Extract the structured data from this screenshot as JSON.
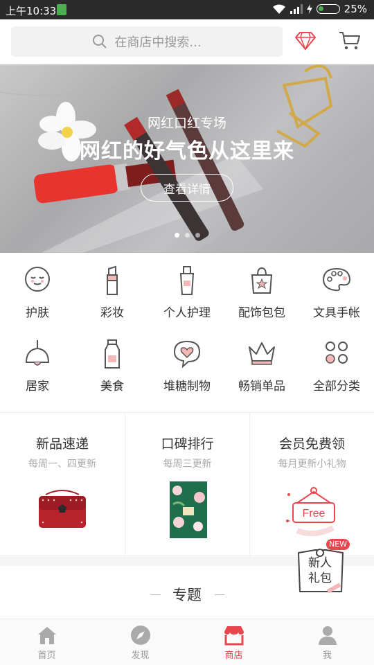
{
  "status_bar": {
    "time": "上午10:33",
    "battery": "25%",
    "battery_level": 0.25
  },
  "search": {
    "placeholder": "在商店中搜索..."
  },
  "banner": {
    "subtitle": "网红口红专场",
    "title": "网红的好气色从这里来",
    "button": "查看详情",
    "active_dot": 0,
    "dot_count": 3
  },
  "categories": [
    {
      "label": "护肤",
      "icon": "face-icon"
    },
    {
      "label": "彩妆",
      "icon": "lipstick-icon"
    },
    {
      "label": "个人护理",
      "icon": "lotion-bottle-icon"
    },
    {
      "label": "配饰包包",
      "icon": "bag-icon"
    },
    {
      "label": "文具手帐",
      "icon": "palette-icon"
    },
    {
      "label": "居家",
      "icon": "lamp-icon"
    },
    {
      "label": "美食",
      "icon": "milk-bottle-icon"
    },
    {
      "label": "堆糖制物",
      "icon": "heart-bubble-icon"
    },
    {
      "label": "畅销单品",
      "icon": "crown-icon"
    },
    {
      "label": "全部分类",
      "icon": "grid-icon"
    }
  ],
  "promos": [
    {
      "title": "新品速递",
      "subtitle": "每周一、四更新"
    },
    {
      "title": "口碑排行",
      "subtitle": "每周三更新"
    },
    {
      "title": "会员免费领",
      "subtitle": "每月更新小礼物",
      "badge_text": "Free"
    }
  ],
  "topic": {
    "title": "专题"
  },
  "gift": {
    "label": "新人礼包",
    "line1": "新人",
    "line2": "礼包",
    "badge": "NEW"
  },
  "nav": [
    {
      "label": "首页",
      "icon": "home-icon",
      "active": false
    },
    {
      "label": "发现",
      "icon": "compass-icon",
      "active": false
    },
    {
      "label": "商店",
      "icon": "store-icon",
      "active": true
    },
    {
      "label": "我",
      "icon": "user-icon",
      "active": false
    }
  ],
  "colors": {
    "accent": "#e8474e",
    "status_bar": "#2b2b2b",
    "icon_stroke": "#555555"
  }
}
